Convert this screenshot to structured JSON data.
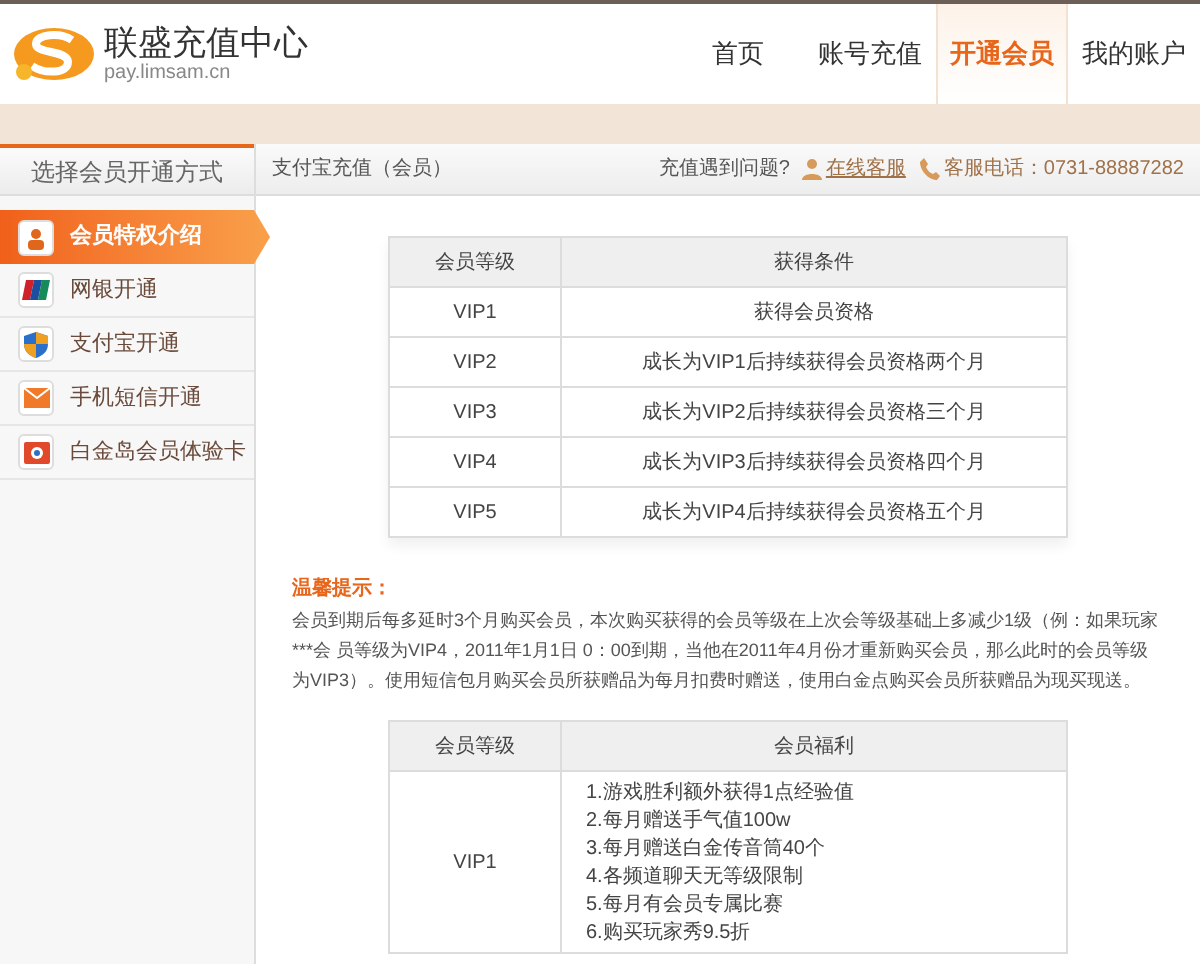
{
  "header": {
    "logo_title": "联盛充值中心",
    "logo_subtitle": "pay.limsam.cn",
    "nav": [
      {
        "label": "首页",
        "selected": false
      },
      {
        "label": "账号充值",
        "selected": false
      },
      {
        "label": "开通会员",
        "selected": true
      },
      {
        "label": "我的账户",
        "selected": false
      }
    ]
  },
  "sidebar": {
    "title": "选择会员开通方式",
    "items": [
      {
        "label": "会员特权介绍",
        "kind": "member",
        "selected": true
      },
      {
        "label": "网银开通",
        "kind": "bank",
        "selected": false
      },
      {
        "label": "支付宝开通",
        "kind": "shield",
        "selected": false
      },
      {
        "label": "手机短信开通",
        "kind": "mail",
        "selected": false
      },
      {
        "label": "白金岛会员体验卡",
        "kind": "card",
        "selected": false
      }
    ]
  },
  "breadcrumb": "支付宝充值（会员）",
  "help": {
    "question": "充值遇到问题?",
    "link": "在线客服",
    "phone": "客服电话：0731-88887282"
  },
  "level_table": {
    "columns": [
      "会员等级",
      "获得条件"
    ],
    "rows": [
      [
        "VIP1",
        "获得会员资格"
      ],
      [
        "VIP2",
        "成长为VIP1后持续获得会员资格两个月"
      ],
      [
        "VIP3",
        "成长为VIP2后持续获得会员资格三个月"
      ],
      [
        "VIP4",
        "成长为VIP3后持续获得会员资格四个月"
      ],
      [
        "VIP5",
        "成长为VIP4后持续获得会员资格五个月"
      ]
    ]
  },
  "notice": {
    "title": "温馨提示：",
    "text": "会员到期后每多延时3个月购买会员，本次购买获得的会员等级在上次会等级基础上多减少1级（例：如果玩家***会 员等级为VIP4，2011年1月1日 0：00到期，当他在2011年4月份才重新购买会员，那么此时的会员等级为VIP3）。使用短信包月购买会员所获赠品为每月扣费时赠送，使用白金点购买会员所获赠品为现买现送。"
  },
  "benefit_table": {
    "columns": [
      "会员等级",
      "会员福利"
    ],
    "rows": [
      {
        "level": "VIP1",
        "benefits": [
          "1.游戏胜利额外获得1点经验值",
          "2.每月赠送手气值100w",
          "3.每月赠送白金传音筒40个",
          "4.各频道聊天无等级限制",
          "5.每月有会员专属比赛",
          "6.购买玩家秀9.5折"
        ]
      }
    ]
  }
}
